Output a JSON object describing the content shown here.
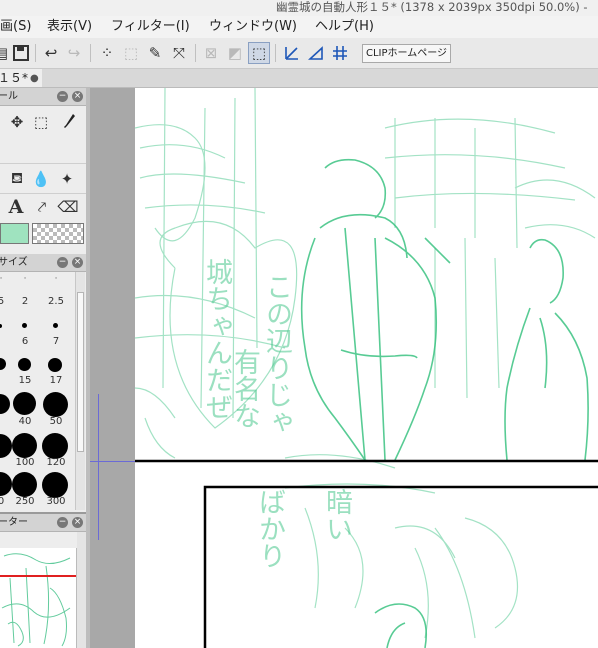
{
  "window": {
    "title": "幽霊城の自動人形１５* (1378 x 2039px 350dpi 50.0%)  -"
  },
  "menu": [
    {
      "label": "画(S)"
    },
    {
      "label": "表示(V)"
    },
    {
      "label": "フィルター(I)"
    },
    {
      "label": "ウィンドウ(W)"
    },
    {
      "label": "ヘルプ(H)"
    }
  ],
  "toolbar": {
    "clip_button_label": "CLIPホームページ"
  },
  "tab": {
    "label": "１５*",
    "modified_dot": "●"
  },
  "tool_panel": {
    "title": "ール"
  },
  "brush_size_panel": {
    "title": "サイズ",
    "sizes": [
      "5",
      "2",
      "2.5",
      "",
      "6",
      "7",
      "",
      "15",
      "17",
      "",
      "40",
      "50",
      "",
      "100",
      "120",
      "0",
      "250",
      "300"
    ]
  },
  "navigator_panel": {
    "title": "ーター"
  },
  "canvas": {
    "sketch_text_1": "城ちゃんだぜ",
    "sketch_text_2": "この辺りじゃ",
    "sketch_text_3": "有名な",
    "sketch_text_4": "ばかり",
    "sketch_text_5": "暗い"
  },
  "colors": {
    "sketch_green": "#2fbf7a",
    "frame_border": "#000000",
    "guide_blue": "#6b6bd6",
    "main_color": "#9fe3bf",
    "nav_marker_red": "#e02020"
  }
}
